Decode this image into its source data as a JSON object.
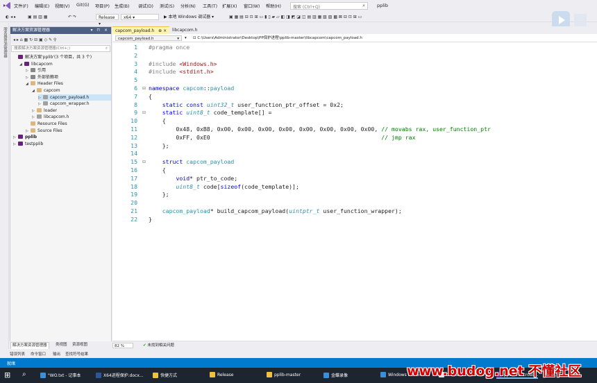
{
  "menu": [
    "文件(F)",
    "编辑(E)",
    "视图(V)",
    "Git(G)",
    "项目(P)",
    "生成(B)",
    "调试(D)",
    "测试(S)",
    "分析(N)",
    "工具(T)",
    "扩展(X)",
    "窗口(W)",
    "帮助(H)"
  ],
  "search": {
    "placeholder": "搜索 (Ctrl+Q)"
  },
  "solution_name": "pplib",
  "toolbar": {
    "config": "Release",
    "platform": "x64",
    "debugger": "▶ 本地 Windows 调试器"
  },
  "left_strip_label": "服务器资源管理器",
  "panel": {
    "title": "解决方案资源管理器",
    "search_placeholder": "搜索解决方案资源管理器(Ctrl+;)",
    "tree": [
      {
        "label": "解决方案'pplib'(3 个项目，共 3 个)",
        "indent": 0,
        "arrow": "",
        "color": "#68217a"
      },
      {
        "label": "libcapcom",
        "indent": 1,
        "arrow": "◢",
        "color": "#68217a"
      },
      {
        "label": "引用",
        "indent": 2,
        "arrow": "▷",
        "color": "#888888"
      },
      {
        "label": "外部依赖项",
        "indent": 2,
        "arrow": "▷",
        "color": "#888888"
      },
      {
        "label": "Header Files",
        "indent": 2,
        "arrow": "◢",
        "color": "#dcb67a"
      },
      {
        "label": "capcom",
        "indent": 3,
        "arrow": "◢",
        "color": "#dcb67a"
      },
      {
        "label": "capcom_payload.h",
        "indent": 4,
        "arrow": "▷",
        "color": "#a0a0a0",
        "selected": true
      },
      {
        "label": "capcom_wrapper.h",
        "indent": 4,
        "arrow": "▷",
        "color": "#a0a0a0"
      },
      {
        "label": "loader",
        "indent": 3,
        "arrow": "▷",
        "color": "#dcb67a"
      },
      {
        "label": "libcapcom.h",
        "indent": 3,
        "arrow": "▷",
        "color": "#a0a0a0"
      },
      {
        "label": "Resource Files",
        "indent": 2,
        "arrow": "",
        "color": "#dcb67a"
      },
      {
        "label": "Source Files",
        "indent": 2,
        "arrow": "▷",
        "color": "#dcb67a"
      },
      {
        "label": "pplib",
        "indent": 0,
        "arrow": "▷",
        "color": "#68217a",
        "bold": true
      },
      {
        "label": "testpplib",
        "indent": 0,
        "arrow": "▷",
        "color": "#68217a"
      }
    ],
    "tabs": [
      "解决方案资源管理器",
      "类视图",
      "资源视图"
    ]
  },
  "editor": {
    "tabs": [
      {
        "label": "capcom_payload.h",
        "active": true,
        "close": "⊕ ×"
      },
      {
        "label": "libcapcom.h",
        "active": false,
        "close": ""
      }
    ],
    "nav": {
      "project": "capcom_payload.h",
      "scope": "",
      "path": "C:\\Users\\Administrator\\Desktop\\PP保护进程\\pplib-master\\libcapcom\\capcom_payload.h"
    },
    "lines": [
      {
        "n": "1",
        "html": "<span class=\"pp\">#pragma once</span>"
      },
      {
        "n": "2",
        "html": ""
      },
      {
        "n": "3",
        "html": "<span class=\"pp\">#include </span><span class=\"inc\">&lt;Windows.h&gt;</span>"
      },
      {
        "n": "4",
        "html": "<span class=\"pp\">#include </span><span class=\"inc\">&lt;stdint.h&gt;</span>"
      },
      {
        "n": "5",
        "html": ""
      },
      {
        "n": "6",
        "html": "<span class=\"kw\">namespace</span> <span class=\"ns\">capcom</span>::<span class=\"ns\">payload</span>"
      },
      {
        "n": "7",
        "html": "{"
      },
      {
        "n": "8",
        "html": "    <span class=\"kw\">static const</span> <span class=\"ty\">uint32_t</span> user_function_ptr_offset = 0x2;"
      },
      {
        "n": "9",
        "html": "    <span class=\"kw\">static</span> <span class=\"ty\">uint8_t</span> code_template[] ="
      },
      {
        "n": "10",
        "html": "    {"
      },
      {
        "n": "11",
        "html": "        0x48, 0xB8, 0x00, 0x00, 0x00, 0x00, 0x00, 0x00, 0x00, 0x00, <span class=\"cm\">// movabs rax, user_function_ptr</span>"
      },
      {
        "n": "12",
        "html": "        0xFF, 0xE0                                                  <span class=\"cm\">// jmp rax</span>"
      },
      {
        "n": "13",
        "html": "    };"
      },
      {
        "n": "14",
        "html": ""
      },
      {
        "n": "15",
        "html": "    <span class=\"kw\">struct</span> <span class=\"ns\">capcom_payload</span>"
      },
      {
        "n": "16",
        "html": "    {"
      },
      {
        "n": "17",
        "html": "        <span class=\"kw\">void</span>* ptr_to_code;"
      },
      {
        "n": "18",
        "html": "        <span class=\"ty\">uint8_t</span> code[<span class=\"kw\">sizeof</span>(code_template)];"
      },
      {
        "n": "19",
        "html": "    };"
      },
      {
        "n": "20",
        "html": ""
      },
      {
        "n": "21",
        "html": "    <span class=\"ns\">capcom_payload</span>* build_capcom_payload(<span class=\"ty\">uintptr_t</span> user_function_wrapper);"
      },
      {
        "n": "22",
        "html": "}"
      }
    ],
    "zoom": "82 %",
    "issues": "未找到相关问题"
  },
  "bottom_tabs": [
    "错误列表",
    "命令窗口",
    "输出",
    "查找符号结果"
  ],
  "status": "就绪",
  "taskbar": [
    {
      "label": "\"WO.txt - 记事本",
      "color": "#3a8fd8"
    },
    {
      "label": "X64进程保护.docx...",
      "color": "#2b579a"
    },
    {
      "label": "快捷方式",
      "color": "#f0c040"
    },
    {
      "label": "Release",
      "color": "#f0c040"
    },
    {
      "label": "pplib-master",
      "color": "#f0c040"
    },
    {
      "label": "金蝶录像",
      "color": "#3a8fd8"
    },
    {
      "label": "Windows 6x x64 ...",
      "color": "#3a8fd8"
    },
    {
      "label": "GitHub - notsom...",
      "color": "#e0e0e0"
    },
    {
      "label": "pplib - Microso...",
      "color": "#68217a"
    }
  ],
  "watermark": "www.budog.net 不懂社区",
  "colors": {
    "accent": "#007acc",
    "vs_purple": "#68217a",
    "panel_title": "#4d6082"
  }
}
